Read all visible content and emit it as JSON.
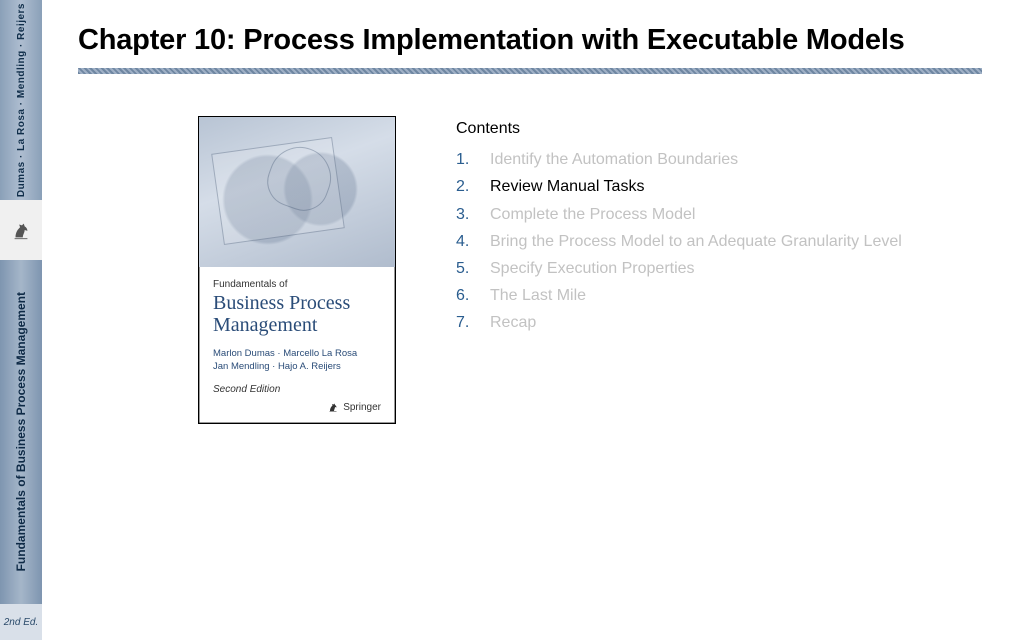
{
  "spine": {
    "authors": "Dumas · La Rosa · Mendling · Reijers",
    "title": "Fundamentals of Business Process Management",
    "edition": "2nd Ed."
  },
  "chapter_title": "Chapter 10: Process Implementation with Executable Models",
  "cover": {
    "pretitle": "Fundamentals of",
    "title": "Business Process Management",
    "authors_line1": "Marlon Dumas · Marcello La Rosa",
    "authors_line2": "Jan Mendling · Hajo A. Reijers",
    "edition": "Second Edition",
    "publisher": "Springer"
  },
  "contents": {
    "heading": "Contents",
    "items": [
      {
        "n": "1.",
        "label": "Identify the Automation Boundaries",
        "active": false
      },
      {
        "n": "2.",
        "label": "Review Manual Tasks",
        "active": true
      },
      {
        "n": "3.",
        "label": "Complete the Process Model",
        "active": false
      },
      {
        "n": "4.",
        "label": "Bring the Process Model to an Adequate Granularity Level",
        "active": false
      },
      {
        "n": "5.",
        "label": "Specify Execution Properties",
        "active": false
      },
      {
        "n": "6.",
        "label": "The Last Mile",
        "active": false
      },
      {
        "n": "7.",
        "label": "Recap",
        "active": false
      }
    ]
  }
}
